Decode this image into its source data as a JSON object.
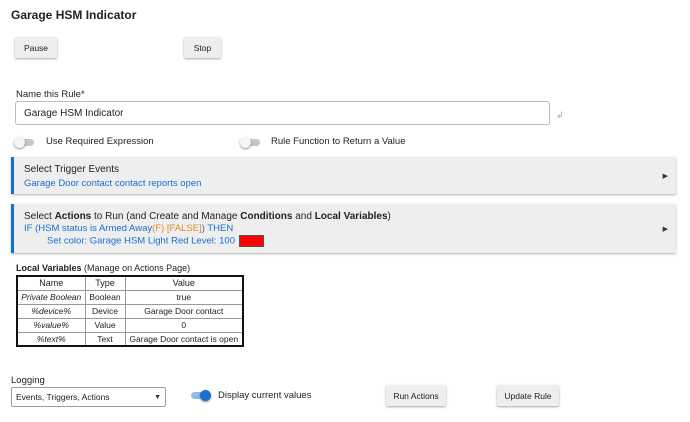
{
  "page": {
    "title": "Garage HSM Indicator"
  },
  "controls": {
    "pause_label": "Pause",
    "stop_label": "Stop"
  },
  "rule_name": {
    "label": "Name this Rule*",
    "value": "Garage HSM Indicator",
    "enter_icon": "return-arrow-icon"
  },
  "toggles": {
    "required_expression": {
      "label": "Use Required Expression",
      "on": false
    },
    "rule_function": {
      "label": "Rule Function to Return a Value",
      "on": false
    },
    "display_values": {
      "label": "Display current values",
      "on": true
    }
  },
  "trigger": {
    "title": "Select Trigger Events",
    "summary": "Garage Door contact contact reports open"
  },
  "actions": {
    "title_pre": "Select ",
    "title_b1": "Actions",
    "title_mid1": " to Run (and Create and Manage ",
    "title_b2": "Conditions",
    "title_mid2": " and ",
    "title_b3": "Local Variables",
    "title_post": ")",
    "line1_pre": "IF (HSM status is Armed Away",
    "line1_false": "(F) [FALSE]",
    "line1_post": ") THEN",
    "line2": "Set color: Garage HSM Light  Red  Level: 100",
    "swatch_color": "#ff0000"
  },
  "local_variables": {
    "title_b": "Local Variables",
    "title_rest": " (Manage on Actions Page)",
    "headers": [
      "Name",
      "Type",
      "Value"
    ],
    "rows": [
      {
        "name": "Private Boolean",
        "type": "Boolean",
        "value": "true"
      },
      {
        "name": "%device%",
        "type": "Device",
        "value": "Garage Door contact"
      },
      {
        "name": "%value%",
        "type": "Value",
        "value": "0"
      },
      {
        "name": "%text%",
        "type": "Text",
        "value": "Garage Door contact is open"
      }
    ]
  },
  "logging": {
    "label": "Logging",
    "selected": "Events, Triggers, Actions"
  },
  "footer": {
    "run_label": "Run Actions",
    "update_label": "Update Rule"
  },
  "colors": {
    "accent": "#1a6fd0",
    "false_text": "#e38a1c",
    "panel_bg": "#eeeeee"
  }
}
